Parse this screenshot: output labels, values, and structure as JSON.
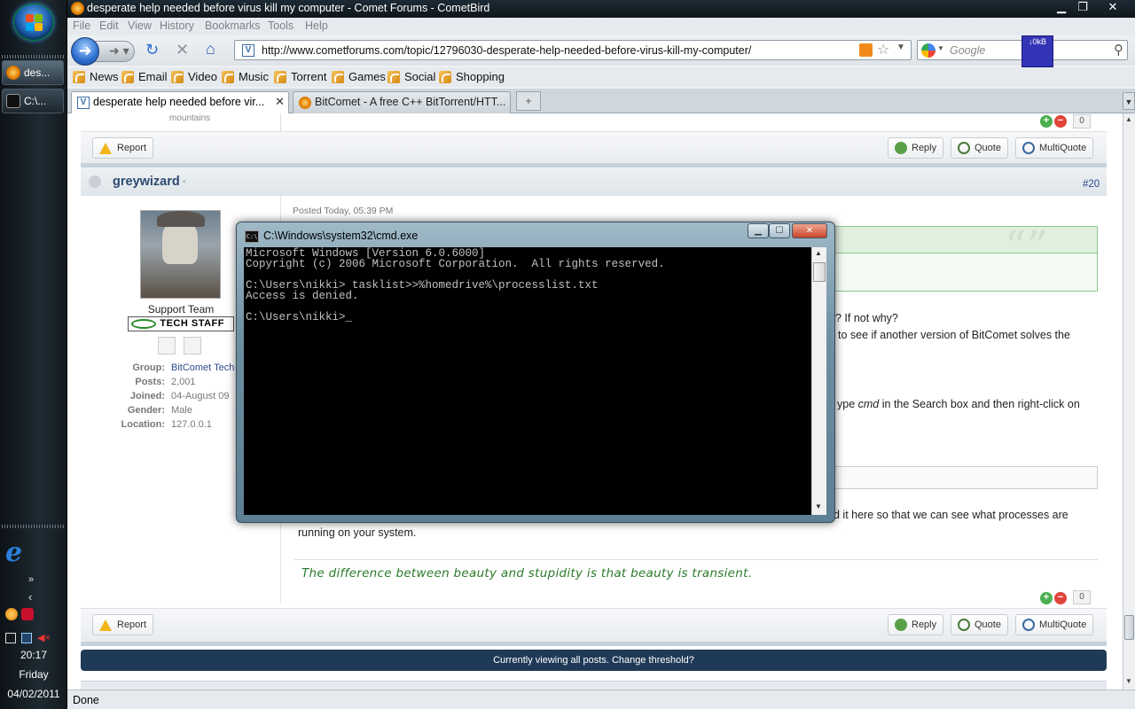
{
  "taskbar": {
    "buttons": [
      {
        "label": "des..."
      },
      {
        "label": "C:\\..."
      }
    ],
    "clock": {
      "time": "20:17",
      "day": "Friday",
      "date": "04/02/2011"
    }
  },
  "browser": {
    "title": "desperate help needed before virus kill my computer - Comet Forums - CometBird",
    "menu": [
      "File",
      "Edit",
      "View",
      "History",
      "Bookmarks",
      "Tools",
      "Help"
    ],
    "url": "http://www.cometforums.com/topic/12796030-desperate-help-needed-before-virus-kill-my-computer/",
    "search_placeholder": "Google",
    "speed_badge": "↓0kB",
    "bookmarks": [
      "News",
      "Email",
      "Video",
      "Music",
      "Torrent",
      "Games",
      "Social",
      "Shopping"
    ],
    "tabs": [
      {
        "label": "desperate help needed before vir..."
      },
      {
        "label": "BitComet - A free C++ BitTorrent/HTT..."
      }
    ],
    "status": "Done",
    "accent": "#2c6fd0"
  },
  "forum": {
    "prev_post": {
      "location_tail": "mountains",
      "vote_count": "0",
      "report_label": "Report",
      "reply_label": "Reply",
      "quote_label": "Quote",
      "multiquote_label": "MultiQuote"
    },
    "post": {
      "author": "greywizard",
      "number": "#20",
      "posted": "Posted Today, 05:39 PM",
      "member_title": "Support Team",
      "badge": "TECH STAFF",
      "fields": [
        {
          "label": "Group:",
          "value": "BitComet Tech"
        },
        {
          "label": "Posts:",
          "value": "2,001"
        },
        {
          "label": "Joined:",
          "value": "04-August 09"
        },
        {
          "label": "Gender:",
          "value": "Male"
        },
        {
          "label": "Location:",
          "value": "127.0.0.1"
        }
      ],
      "body_fragments": [
        "? If not why?",
        "to see if another version of BitComet solves the",
        "ype",
        "cmd",
        "in the Search box and then right-click on",
        "d it here so that we can see what processes are",
        "running on your system."
      ],
      "signature": "The difference between beauty and stupidity is that beauty is transient.",
      "vote_count": "0",
      "report_label": "Report",
      "reply_label": "Reply",
      "quote_label": "Quote",
      "multiquote_label": "MultiQuote"
    },
    "threshold_bar": "Currently viewing all posts. Change threshold?"
  },
  "cmd": {
    "title": "C:\\Windows\\system32\\cmd.exe",
    "lines": [
      "Microsoft Windows [Version 6.0.6000]",
      "Copyright (c) 2006 Microsoft Corporation.  All rights reserved.",
      "",
      "C:\\Users\\nikki> tasklist>>%homedrive%\\processlist.txt",
      "Access is denied.",
      "",
      "C:\\Users\\nikki>_"
    ]
  }
}
